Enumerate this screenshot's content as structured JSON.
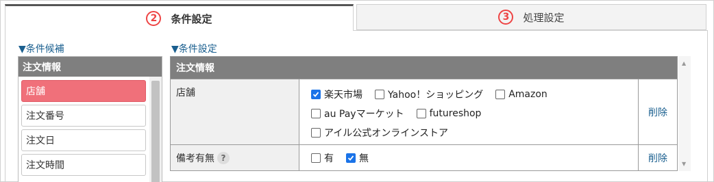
{
  "tabs": [
    {
      "num": "2",
      "label": "条件設定",
      "active": true
    },
    {
      "num": "3",
      "label": "処理設定",
      "active": false
    }
  ],
  "candidates": {
    "title": "▼条件候補",
    "header": "注文情報",
    "items": [
      "店舗",
      "注文番号",
      "注文日",
      "注文時間"
    ]
  },
  "conditions": {
    "title": "▼条件設定",
    "header": "注文情報",
    "rows": [
      {
        "name": "店舗",
        "delete_label": "削除",
        "lines": [
          [
            {
              "label": "楽天市場",
              "checked": true
            },
            {
              "label": "Yahoo！ショッピング",
              "checked": false
            },
            {
              "label": "Amazon",
              "checked": false
            }
          ],
          [
            {
              "label": "au Payマーケット",
              "checked": false
            },
            {
              "label": "futureshop",
              "checked": false
            }
          ],
          [
            {
              "label": "アイル公式オンラインストア",
              "checked": false
            }
          ]
        ]
      },
      {
        "name": "備考有無",
        "help": "?",
        "delete_label": "削除",
        "lines": [
          [
            {
              "label": "有",
              "checked": false
            },
            {
              "label": "無",
              "checked": true
            }
          ]
        ]
      }
    ]
  },
  "colors": {
    "accent_red": "#e44444",
    "active_candidate": "#f0707a",
    "header_gray": "#7f7f7f",
    "link_blue": "#1a5f8f",
    "checkbox_blue": "#1a73e8"
  }
}
